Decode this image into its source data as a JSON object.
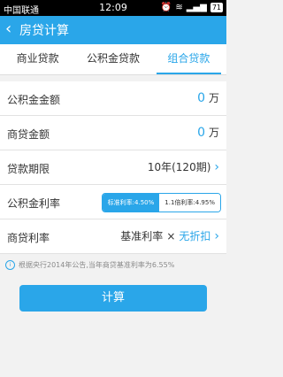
{
  "status": {
    "carrier": "中国联通",
    "time": "12:09",
    "battery": "71"
  },
  "appbar": {
    "title": "房贷计算"
  },
  "tabs": [
    {
      "label": "商业贷款"
    },
    {
      "label": "公积金贷款"
    },
    {
      "label": "组合贷款"
    }
  ],
  "form": {
    "fund_amount": {
      "label": "公积金金额",
      "value": "0",
      "unit": "万"
    },
    "biz_amount": {
      "label": "商贷金额",
      "value": "0",
      "unit": "万"
    },
    "term": {
      "label": "贷款期限",
      "value": "10年(120期)"
    },
    "fund_rate": {
      "label": "公积金利率",
      "options": [
        "标准利率:4.50%",
        "1.1倍利率:4.95%"
      ]
    },
    "biz_rate": {
      "label": "商贷利率",
      "base": "基准利率",
      "times": "×",
      "discount": "无折扣"
    }
  },
  "note": "根据央行2014年公告,当年商贷基准利率为6.55%",
  "calc_label": "计算"
}
